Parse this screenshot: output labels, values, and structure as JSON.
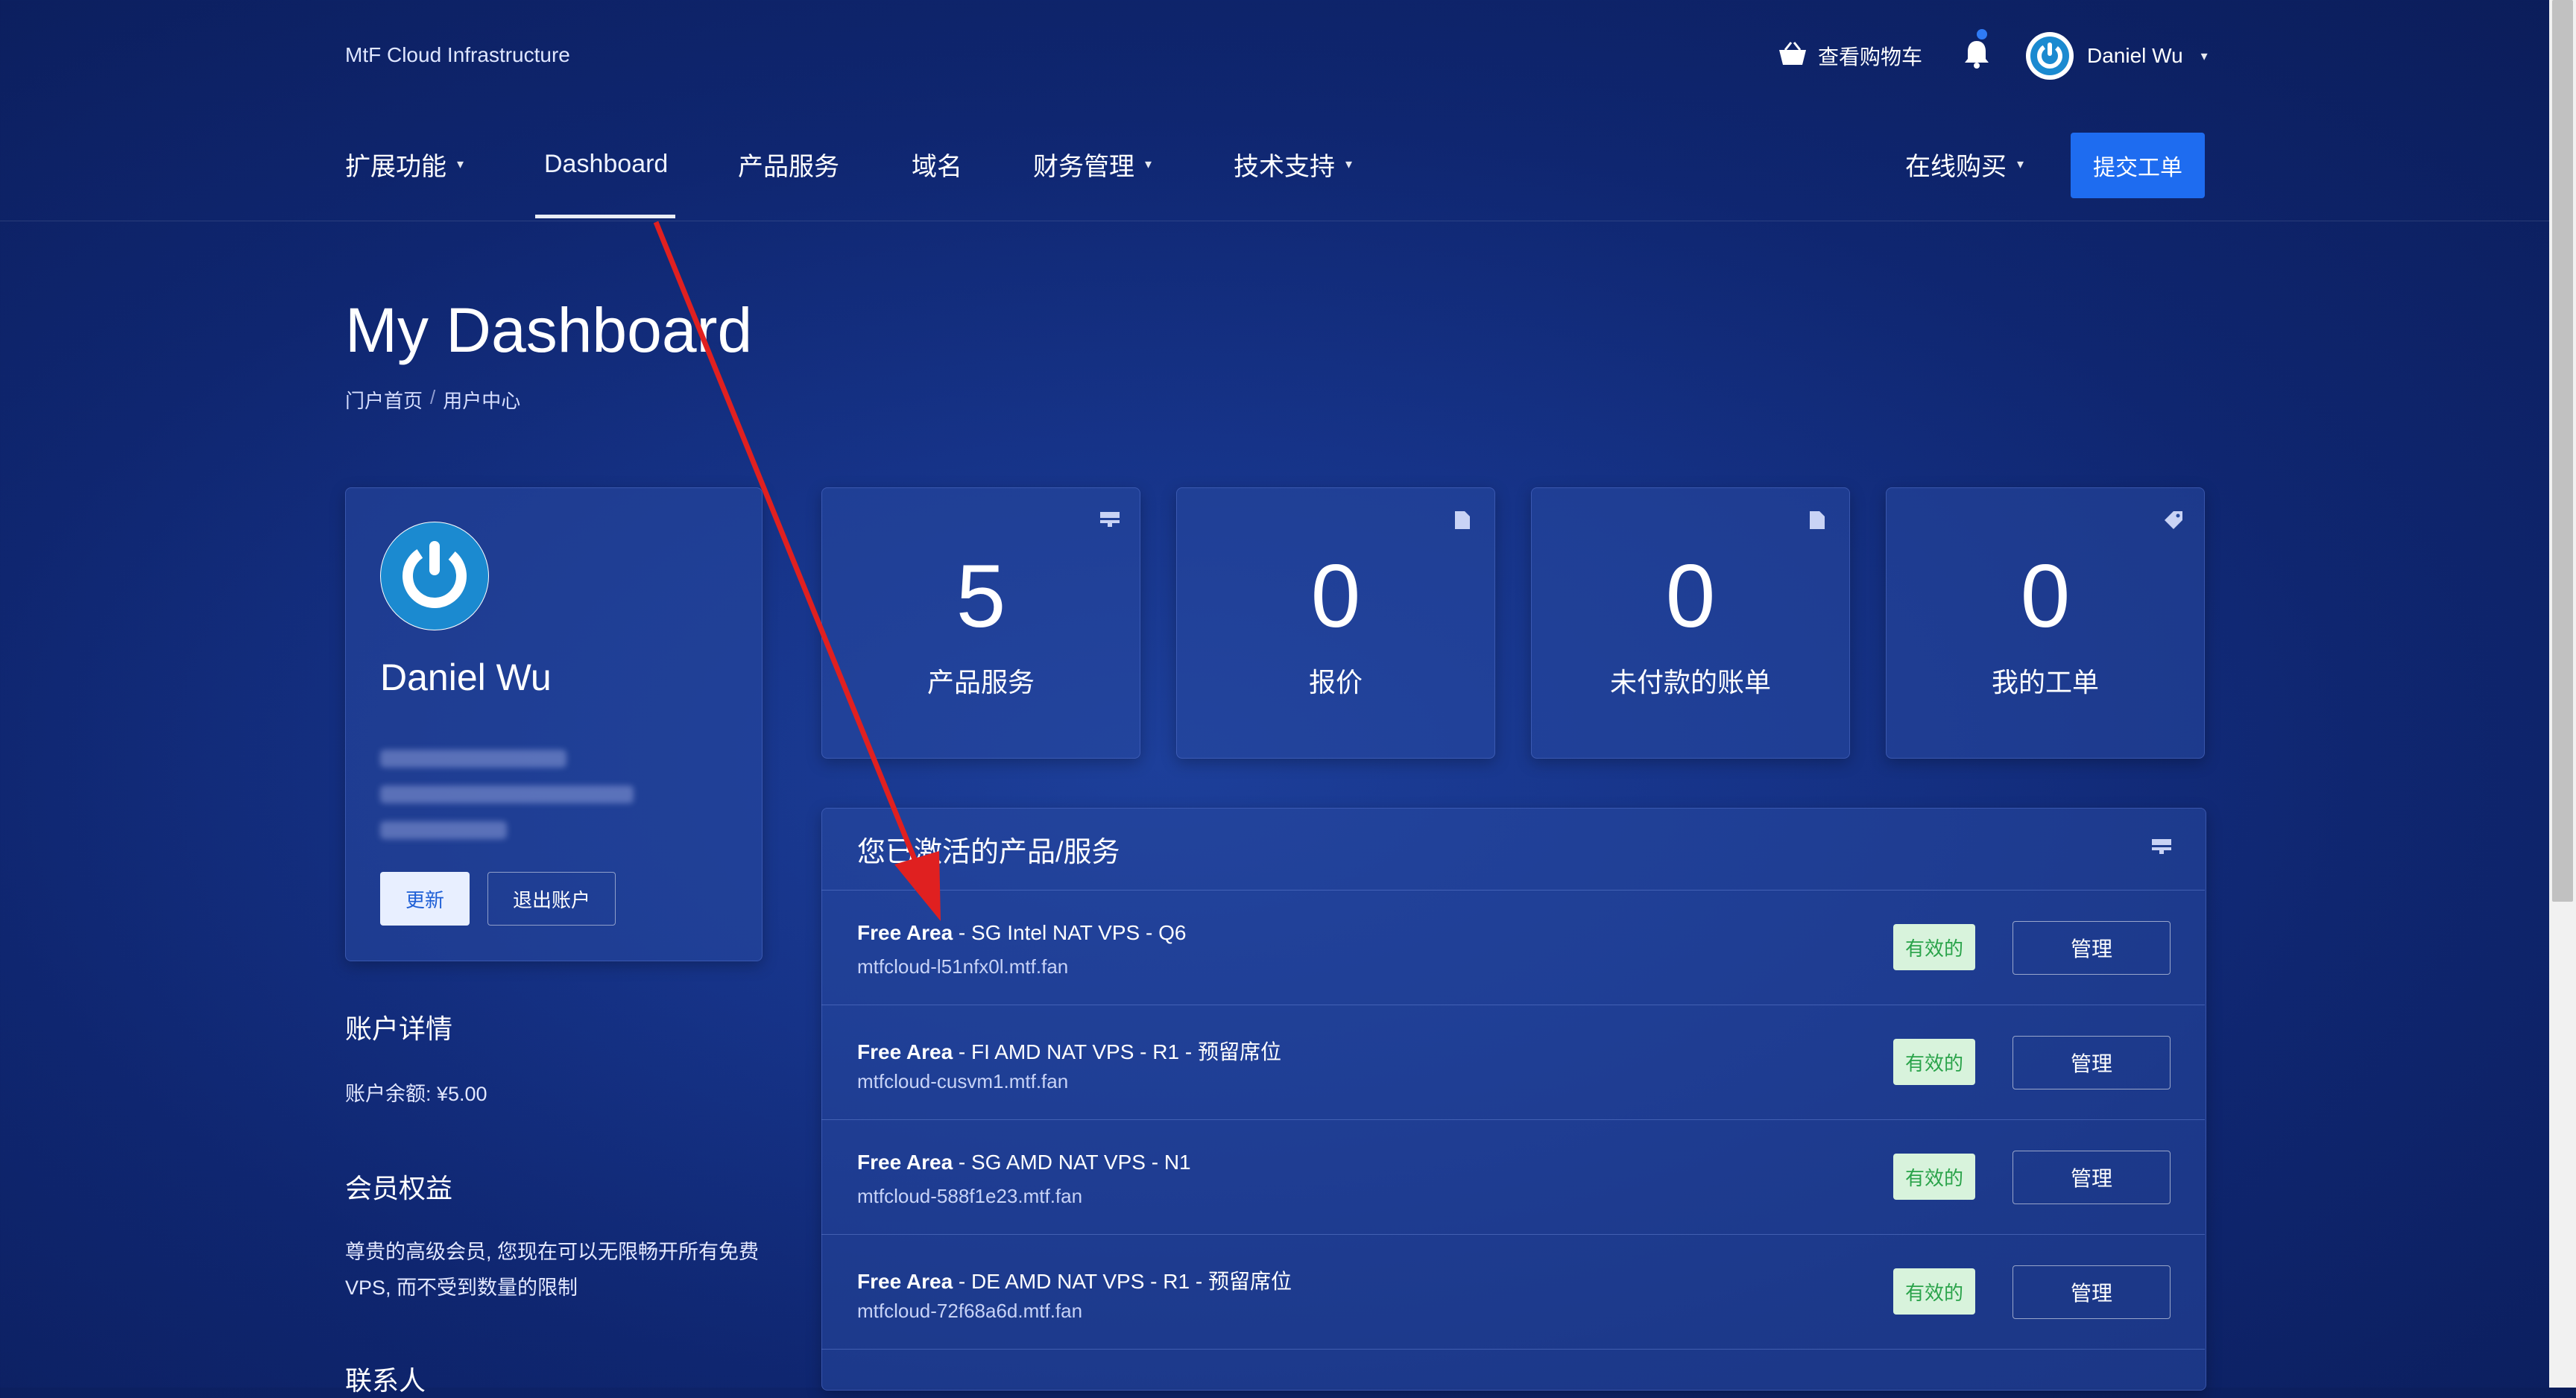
{
  "header": {
    "brand": "MtF Cloud Infrastructure",
    "cart_label": "查看购物车",
    "user_name": "Daniel Wu"
  },
  "nav": {
    "items": [
      {
        "label": "扩展功能"
      },
      {
        "label": "Dashboard"
      },
      {
        "label": "产品服务"
      },
      {
        "label": "域名"
      },
      {
        "label": "财务管理"
      },
      {
        "label": "技术支持"
      }
    ],
    "right_menu": "在线购买",
    "submit_ticket": "提交工单"
  },
  "page": {
    "title": "My Dashboard",
    "breadcrumb": [
      "门户首页",
      "用户中心"
    ]
  },
  "profile": {
    "name": "Daniel Wu",
    "update_label": "更新",
    "logout_label": "退出账户"
  },
  "account": {
    "heading": "账户详情",
    "balance": "账户余额: ¥5.00"
  },
  "membership": {
    "heading": "会员权益",
    "text": "尊贵的高级会员, 您现在可以无限畅开所有免费VPS, 而不受到数量的限制"
  },
  "contacts": {
    "heading": "联系人"
  },
  "stats": [
    {
      "value": "5",
      "label": "产品服务"
    },
    {
      "value": "0",
      "label": "报价"
    },
    {
      "value": "0",
      "label": "未付款的账单"
    },
    {
      "value": "0",
      "label": "我的工单"
    }
  ],
  "services": {
    "heading": "您已激活的产品/服务",
    "items": [
      {
        "group": "Free Area",
        "name": " - SG Intel NAT VPS - Q6",
        "host": "mtfcloud-l51nfx0l.mtf.fan",
        "status": "有效的",
        "action": "管理"
      },
      {
        "group": "Free Area",
        "name": " - FI AMD NAT VPS - R1 - 预留席位",
        "host": "mtfcloud-cusvm1.mtf.fan",
        "status": "有效的",
        "action": "管理"
      },
      {
        "group": "Free Area",
        "name": " - SG AMD NAT VPS - N1",
        "host": "mtfcloud-588f1e23.mtf.fan",
        "status": "有效的",
        "action": "管理"
      },
      {
        "group": "Free Area",
        "name": " - DE AMD NAT VPS - R1 - 预留席位",
        "host": "mtfcloud-72f68a6d.mtf.fan",
        "status": "有效的",
        "action": "管理"
      }
    ]
  },
  "colors": {
    "accent": "#1e6cf0",
    "badge_bg": "#d8f3dc",
    "badge_text": "#2aa34a",
    "annotation_arrow": "#e02020"
  }
}
